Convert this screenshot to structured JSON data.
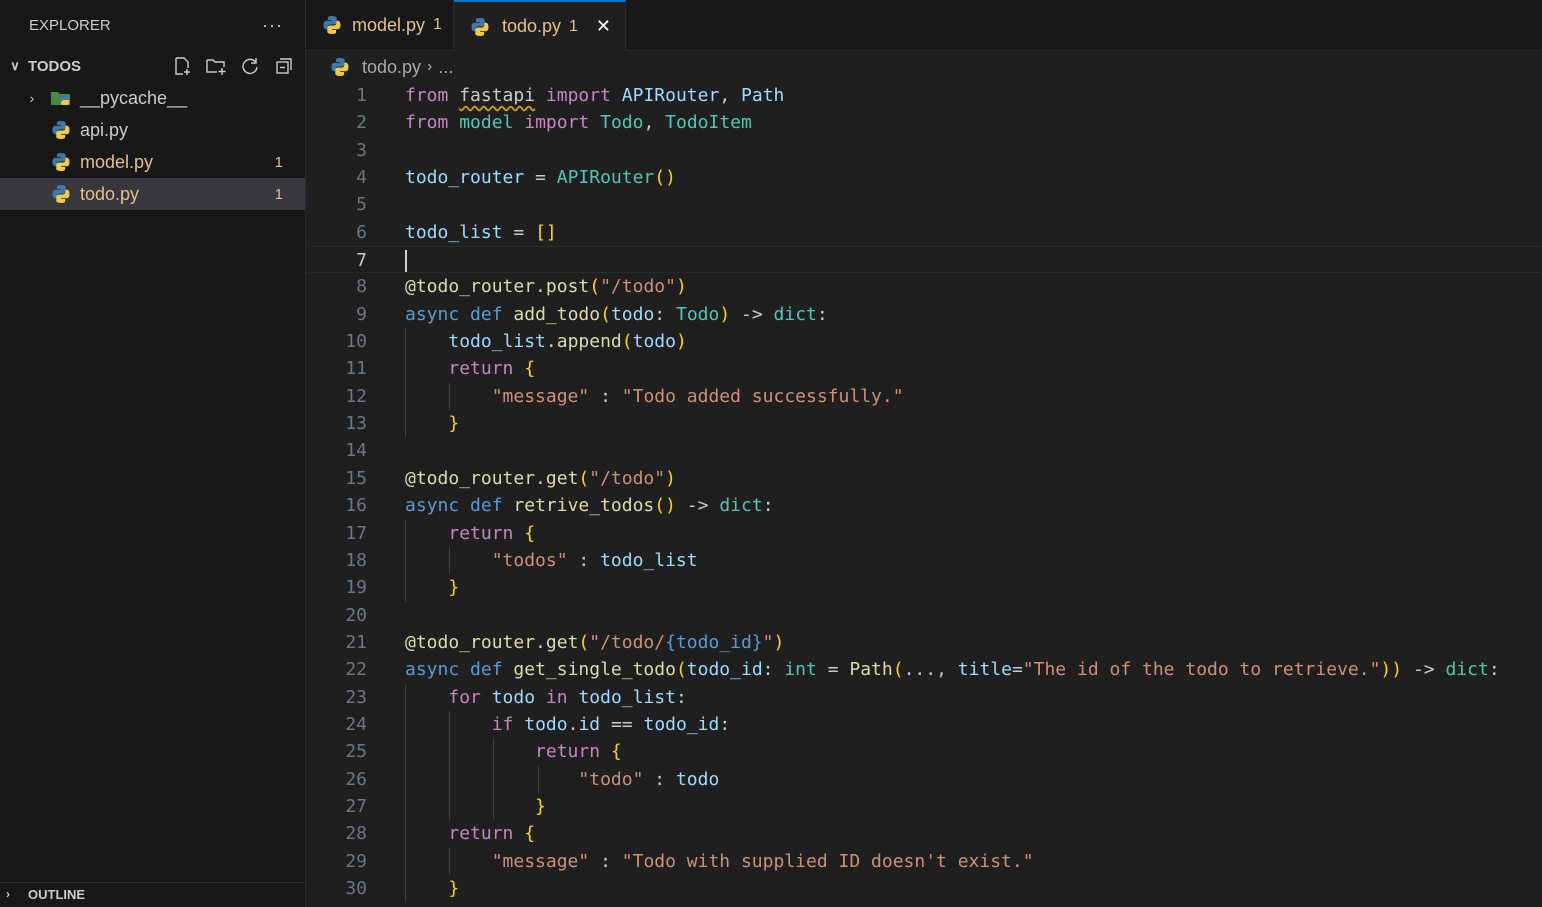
{
  "sidebar": {
    "title": "EXPLORER",
    "more_label": "···",
    "folder": {
      "name": "TODOS",
      "chevron": "∨"
    },
    "items": [
      {
        "label": "__pycache__",
        "type": "folder",
        "modified": false,
        "badge": ""
      },
      {
        "label": "api.py",
        "type": "python",
        "modified": false,
        "badge": ""
      },
      {
        "label": "model.py",
        "type": "python",
        "modified": true,
        "badge": "1"
      },
      {
        "label": "todo.py",
        "type": "python",
        "modified": true,
        "badge": "1",
        "selected": true
      }
    ],
    "outline_label": "OUTLINE",
    "actions": [
      "new-file-icon",
      "new-folder-icon",
      "refresh-icon",
      "collapse-all-icon"
    ]
  },
  "tabs": [
    {
      "label": "model.py",
      "count": "1",
      "active": false
    },
    {
      "label": "todo.py",
      "count": "1",
      "active": true,
      "close": "✕"
    }
  ],
  "breadcrumb": {
    "file": "todo.py",
    "separator": "›",
    "more": "..."
  },
  "editor": {
    "current_line": 7,
    "lines": [
      [
        [
          "kw",
          "from"
        ],
        [
          "pn",
          " "
        ],
        [
          "sq",
          "fastapi"
        ],
        [
          "pn",
          " "
        ],
        [
          "kw",
          "import"
        ],
        [
          "pn",
          " "
        ],
        [
          "vr",
          "APIRouter"
        ],
        [
          "pn",
          ", "
        ],
        [
          "vr",
          "Path"
        ]
      ],
      [
        [
          "kw",
          "from"
        ],
        [
          "pn",
          " "
        ],
        [
          "ty",
          "model"
        ],
        [
          "pn",
          " "
        ],
        [
          "kw",
          "import"
        ],
        [
          "pn",
          " "
        ],
        [
          "ty",
          "Todo"
        ],
        [
          "pn",
          ", "
        ],
        [
          "ty",
          "TodoItem"
        ]
      ],
      [],
      [
        [
          "vr",
          "todo_router"
        ],
        [
          "pn",
          " = "
        ],
        [
          "ty",
          "APIRouter"
        ],
        [
          "br",
          "()"
        ]
      ],
      [],
      [
        [
          "vr",
          "todo_list"
        ],
        [
          "pn",
          " = "
        ],
        [
          "br",
          "[]"
        ]
      ],
      [],
      [
        [
          "fn",
          "@todo_router"
        ],
        [
          "pn",
          "."
        ],
        [
          "fn",
          "post"
        ],
        [
          "br",
          "("
        ],
        [
          "st",
          "\"/todo\""
        ],
        [
          "br",
          ")"
        ]
      ],
      [
        [
          "dk",
          "async"
        ],
        [
          "pn",
          " "
        ],
        [
          "dk",
          "def"
        ],
        [
          "pn",
          " "
        ],
        [
          "fn",
          "add_todo"
        ],
        [
          "br",
          "("
        ],
        [
          "vr",
          "todo"
        ],
        [
          "pn",
          ": "
        ],
        [
          "ty",
          "Todo"
        ],
        [
          "br",
          ")"
        ],
        [
          "pn",
          " -> "
        ],
        [
          "ty",
          "dict"
        ],
        [
          "pn",
          ":"
        ]
      ],
      [
        [
          "pn",
          "    "
        ],
        [
          "vr",
          "todo_list"
        ],
        [
          "pn",
          "."
        ],
        [
          "fn",
          "append"
        ],
        [
          "br",
          "("
        ],
        [
          "vr",
          "todo"
        ],
        [
          "br",
          ")"
        ]
      ],
      [
        [
          "pn",
          "    "
        ],
        [
          "kw",
          "return"
        ],
        [
          "pn",
          " "
        ],
        [
          "br",
          "{"
        ]
      ],
      [
        [
          "pn",
          "        "
        ],
        [
          "st",
          "\"message\""
        ],
        [
          "pn",
          " : "
        ],
        [
          "st",
          "\"Todo added successfully.\""
        ]
      ],
      [
        [
          "pn",
          "    "
        ],
        [
          "br",
          "}"
        ]
      ],
      [],
      [
        [
          "fn",
          "@todo_router"
        ],
        [
          "pn",
          "."
        ],
        [
          "fn",
          "get"
        ],
        [
          "br",
          "("
        ],
        [
          "st",
          "\"/todo\""
        ],
        [
          "br",
          ")"
        ]
      ],
      [
        [
          "dk",
          "async"
        ],
        [
          "pn",
          " "
        ],
        [
          "dk",
          "def"
        ],
        [
          "pn",
          " "
        ],
        [
          "fn",
          "retrive_todos"
        ],
        [
          "br",
          "()"
        ],
        [
          "pn",
          " -> "
        ],
        [
          "ty",
          "dict"
        ],
        [
          "pn",
          ":"
        ]
      ],
      [
        [
          "pn",
          "    "
        ],
        [
          "kw",
          "return"
        ],
        [
          "pn",
          " "
        ],
        [
          "br",
          "{"
        ]
      ],
      [
        [
          "pn",
          "        "
        ],
        [
          "st",
          "\"todos\""
        ],
        [
          "pn",
          " : "
        ],
        [
          "vr",
          "todo_list"
        ]
      ],
      [
        [
          "pn",
          "    "
        ],
        [
          "br",
          "}"
        ]
      ],
      [],
      [
        [
          "fn",
          "@todo_router"
        ],
        [
          "pn",
          "."
        ],
        [
          "fn",
          "get"
        ],
        [
          "br",
          "("
        ],
        [
          "st",
          "\"/todo/"
        ],
        [
          "dk",
          "{todo_id}"
        ],
        [
          "st",
          "\""
        ],
        [
          "br",
          ")"
        ]
      ],
      [
        [
          "dk",
          "async"
        ],
        [
          "pn",
          " "
        ],
        [
          "dk",
          "def"
        ],
        [
          "pn",
          " "
        ],
        [
          "fn",
          "get_single_todo"
        ],
        [
          "br",
          "("
        ],
        [
          "vr",
          "todo_id"
        ],
        [
          "pn",
          ": "
        ],
        [
          "ty",
          "int"
        ],
        [
          "pn",
          " = "
        ],
        [
          "fn",
          "Path"
        ],
        [
          "br",
          "("
        ],
        [
          "pn",
          "..., "
        ],
        [
          "vr",
          "title"
        ],
        [
          "pn",
          "="
        ],
        [
          "st",
          "\"The id of the todo to retrieve.\""
        ],
        [
          "br",
          "))"
        ],
        [
          "pn",
          " -> "
        ],
        [
          "ty",
          "dict"
        ],
        [
          "pn",
          ":"
        ]
      ],
      [
        [
          "pn",
          "    "
        ],
        [
          "kw",
          "for"
        ],
        [
          "pn",
          " "
        ],
        [
          "vr",
          "todo"
        ],
        [
          "pn",
          " "
        ],
        [
          "kw",
          "in"
        ],
        [
          "pn",
          " "
        ],
        [
          "vr",
          "todo_list"
        ],
        [
          "pn",
          ":"
        ]
      ],
      [
        [
          "pn",
          "        "
        ],
        [
          "kw",
          "if"
        ],
        [
          "pn",
          " "
        ],
        [
          "vr",
          "todo"
        ],
        [
          "pn",
          "."
        ],
        [
          "vr",
          "id"
        ],
        [
          "pn",
          " == "
        ],
        [
          "vr",
          "todo_id"
        ],
        [
          "pn",
          ":"
        ]
      ],
      [
        [
          "pn",
          "            "
        ],
        [
          "kw",
          "return"
        ],
        [
          "pn",
          " "
        ],
        [
          "br",
          "{"
        ]
      ],
      [
        [
          "pn",
          "                "
        ],
        [
          "st",
          "\"todo\""
        ],
        [
          "pn",
          " : "
        ],
        [
          "vr",
          "todo"
        ]
      ],
      [
        [
          "pn",
          "            "
        ],
        [
          "br",
          "}"
        ]
      ],
      [
        [
          "pn",
          "    "
        ],
        [
          "kw",
          "return"
        ],
        [
          "pn",
          " "
        ],
        [
          "br",
          "{"
        ]
      ],
      [
        [
          "pn",
          "        "
        ],
        [
          "st",
          "\"message\""
        ],
        [
          "pn",
          " : "
        ],
        [
          "st",
          "\"Todo with supplied ID doesn't exist.\""
        ]
      ],
      [
        [
          "pn",
          "    "
        ],
        [
          "br",
          "}"
        ]
      ]
    ],
    "guides": [
      [
        10,
        13,
        1
      ],
      [
        17,
        19,
        1
      ],
      [
        23,
        30,
        1
      ],
      [
        12,
        12,
        2
      ],
      [
        18,
        18,
        2
      ],
      [
        24,
        27,
        2
      ],
      [
        29,
        29,
        2
      ],
      [
        25,
        27,
        3
      ],
      [
        26,
        26,
        4
      ]
    ]
  }
}
